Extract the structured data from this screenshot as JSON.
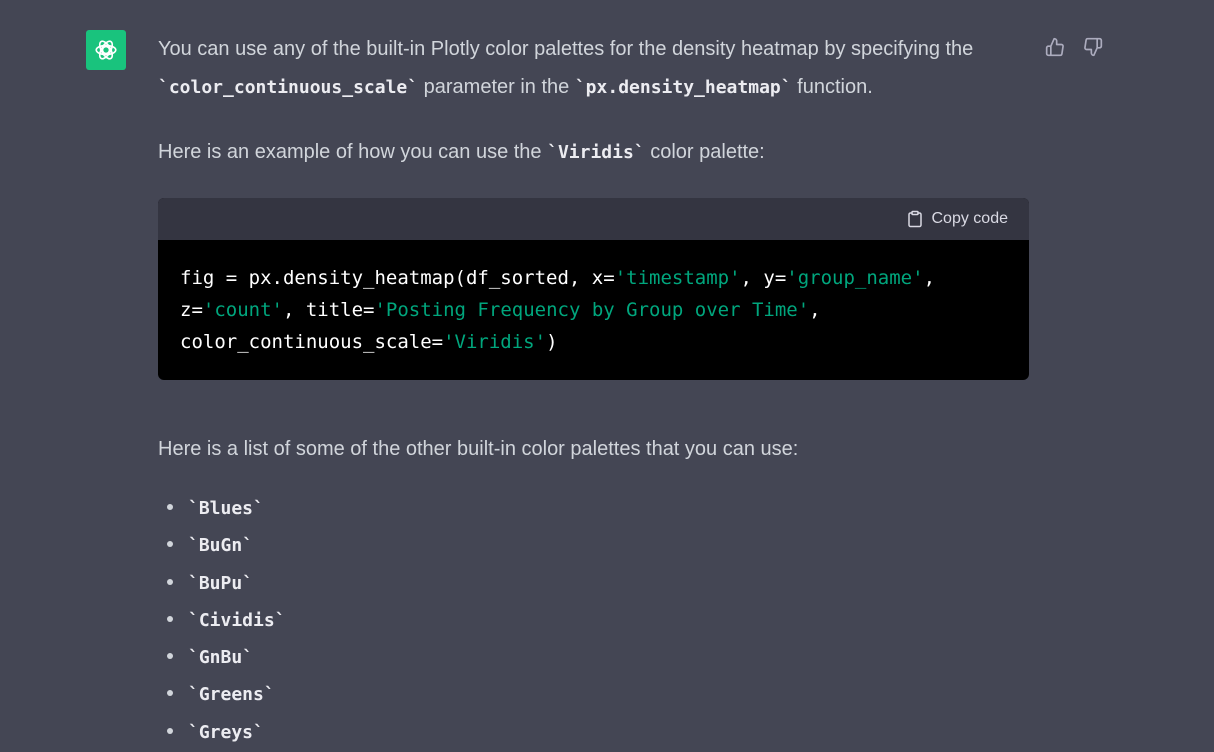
{
  "message": {
    "intro_part1": "You can use any of the built-in Plotly color palettes for the density heatmap by specifying the",
    "intro_code1": "`color_continuous_scale`",
    "intro_part2": " parameter in the ",
    "intro_code2": "`px.density_heatmap`",
    "intro_part3": " function.",
    "example_part1": "Here is an example of how you can use the ",
    "example_code": "`Viridis`",
    "example_part2": " color palette:",
    "list_intro": "Here is a list of some of the other built-in color palettes that you can use:",
    "palettes": [
      "`Blues`",
      "`BuGn`",
      "`BuPu`",
      "`Cividis`",
      "`GnBu`",
      "`Greens`",
      "`Greys`"
    ]
  },
  "code_block": {
    "copy_label": "Copy code",
    "l1_a": "fig = px.density_heatmap(df_sorted, x=",
    "l1_s1": "'timestamp'",
    "l1_b": ", y=",
    "l1_s2": "'group_name'",
    "l1_c": ",",
    "l2_a": "z=",
    "l2_s1": "'count'",
    "l2_b": ", title=",
    "l2_s2": "'Posting Frequency by Group over Time'",
    "l2_c": ",",
    "l3_a": "color_continuous_scale=",
    "l3_s1": "'Viridis'",
    "l3_b": ")"
  },
  "icons": {
    "avatar": "openai-logo-icon",
    "thumbs_up": "thumbs-up-icon",
    "thumbs_down": "thumbs-down-icon",
    "copy": "clipboard-icon"
  },
  "colors": {
    "background": "#444654",
    "avatar": "#19c37d",
    "code_string": "#00a67d"
  }
}
